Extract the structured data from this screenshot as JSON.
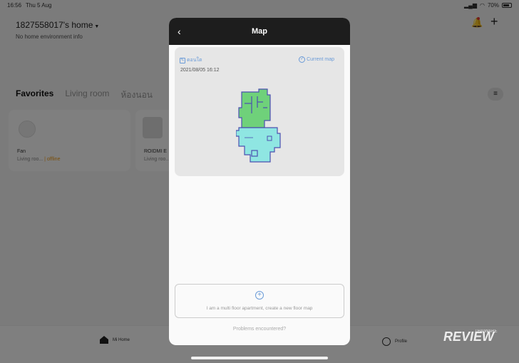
{
  "status": {
    "time": "16:56",
    "date": "Thu 5 Aug",
    "battery": "70%"
  },
  "home": {
    "title": "1827558017's home",
    "subtitle": "No home environment info"
  },
  "tabs": [
    {
      "label": "Favorites"
    },
    {
      "label": "Living room"
    },
    {
      "label": "ห้องนอน"
    }
  ],
  "cards": [
    {
      "name": "Fan",
      "room": "Living roo...",
      "status": "| offline"
    },
    {
      "name": "ROIDMI E",
      "room": "Living roo..."
    }
  ],
  "bottom_nav": {
    "home": "Mi Home",
    "profile": "Profile"
  },
  "modal": {
    "title": "Map",
    "map_name": "ดอนใต",
    "current_map": "Current map",
    "date": "2021/08/05 16:12",
    "add_floor": "I am a multi floor apartment, create a new floor map",
    "problems": "Problems encountered?"
  },
  "watermark": {
    "brand": "REVIEW",
    "small": "THAIWARE"
  },
  "colors": {
    "accent": "#6a9bd8",
    "map_green": "#6fd17a",
    "map_cyan": "#8fe6e2",
    "wall": "#4b4fb0"
  }
}
